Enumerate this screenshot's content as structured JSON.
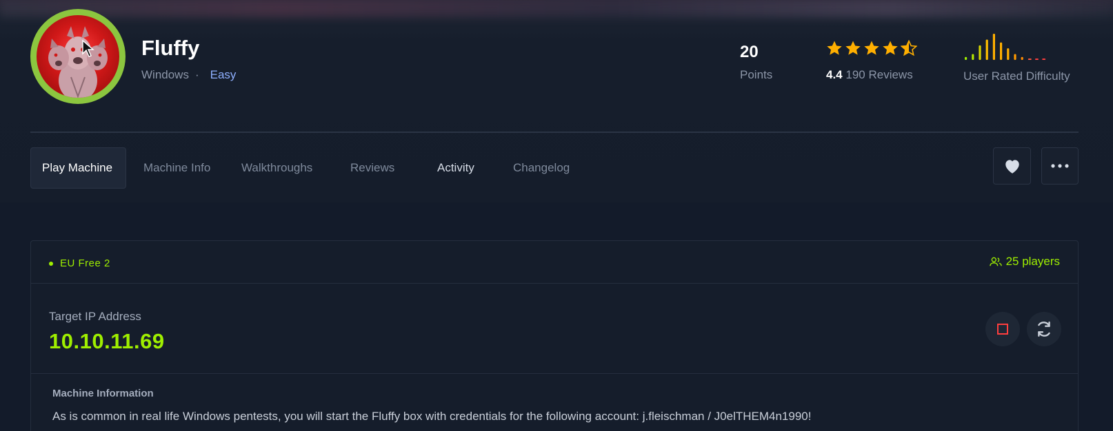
{
  "machine": {
    "name": "Fluffy",
    "os": "Windows",
    "separator": "·",
    "difficulty": "Easy",
    "avatar_icon": "cerberus-avatar-icon"
  },
  "stats": {
    "points_value": "20",
    "points_label": "Points",
    "rating_value": "4.4",
    "rating_count": "190 Reviews",
    "stars": 4.5,
    "user_difficulty_label": "User Rated Difficulty",
    "user_difficulty_distribution": [
      1,
      2,
      5,
      7,
      9,
      6,
      4,
      2,
      1,
      0,
      0,
      0
    ]
  },
  "tabs": [
    {
      "label": "Play Machine",
      "active": true
    },
    {
      "label": "Machine Info",
      "active": false
    },
    {
      "label": "Walkthroughs",
      "active": false
    },
    {
      "label": "Reviews",
      "active": false
    },
    {
      "label": "Activity",
      "active": false
    },
    {
      "label": "Changelog",
      "active": false
    }
  ],
  "actions": {
    "favorite_icon": "heart-icon",
    "more_icon": "more-horizontal-icon"
  },
  "instance": {
    "server": "EU Free 2",
    "players": "25 players",
    "target_label": "Target IP Address",
    "target_ip": "10.10.11.69",
    "stop_icon": "stop-icon",
    "reset_icon": "refresh-icon"
  },
  "info": {
    "heading": "Machine Information",
    "text": "As is common in real life Windows pentests, you will start the Fluffy box with credentials for the following account: j.fleischman / J0elTHEM4n1990!"
  },
  "colors": {
    "accent_green": "#9fef00",
    "easy_blue": "#8fb0ff",
    "star_orange": "#ffaf00",
    "avatar_ring": "#8cc63f",
    "stop_red": "#ff3e3e"
  }
}
